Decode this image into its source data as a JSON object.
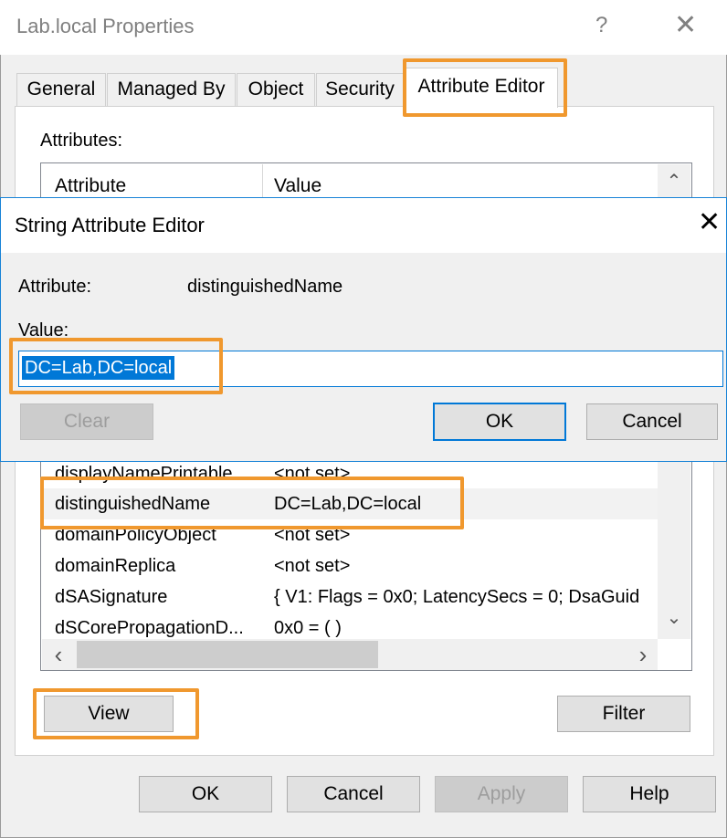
{
  "outer_window": {
    "title": "Lab.local Properties",
    "help_glyph": "?",
    "close_glyph": "✕",
    "tabs": [
      {
        "label": "General",
        "active": false
      },
      {
        "label": "Managed By",
        "active": false
      },
      {
        "label": "Object",
        "active": false
      },
      {
        "label": "Security",
        "active": false
      },
      {
        "label": "Attribute Editor",
        "active": true
      }
    ],
    "attributes_label": "Attributes:",
    "columns": [
      "Attribute",
      "Value"
    ],
    "rows": [
      {
        "attribute": "displayNamePrintable",
        "value": "<not set>"
      },
      {
        "attribute": "distinguishedName",
        "value": "DC=Lab,DC=local",
        "selected": true
      },
      {
        "attribute": "domainPolicyObject",
        "value": "<not set>"
      },
      {
        "attribute": "domainReplica",
        "value": "<not set>"
      },
      {
        "attribute": "dSASignature",
        "value": "{ V1: Flags = 0x0; LatencySecs = 0; DsaGuid"
      },
      {
        "attribute": "dSCorePropagationD...",
        "value": "0x0 = ( )"
      }
    ],
    "scroll": {
      "up": "⌃",
      "down": "⌄",
      "left": "‹",
      "right": "›"
    },
    "view_button": "View",
    "filter_button": "Filter",
    "ok_button": "OK",
    "cancel_button": "Cancel",
    "apply_button": "Apply",
    "help_button": "Help"
  },
  "string_editor": {
    "title": "String Attribute Editor",
    "close_glyph": "✕",
    "attribute_label": "Attribute:",
    "attribute_name": "distinguishedName",
    "value_label": "Value:",
    "value": "DC=Lab,DC=local",
    "clear_button": "Clear",
    "ok_button": "OK",
    "cancel_button": "Cancel"
  },
  "colors": {
    "highlight": "#f0982e",
    "accent": "#0078d7",
    "window_bg": "#f0f0f0"
  }
}
